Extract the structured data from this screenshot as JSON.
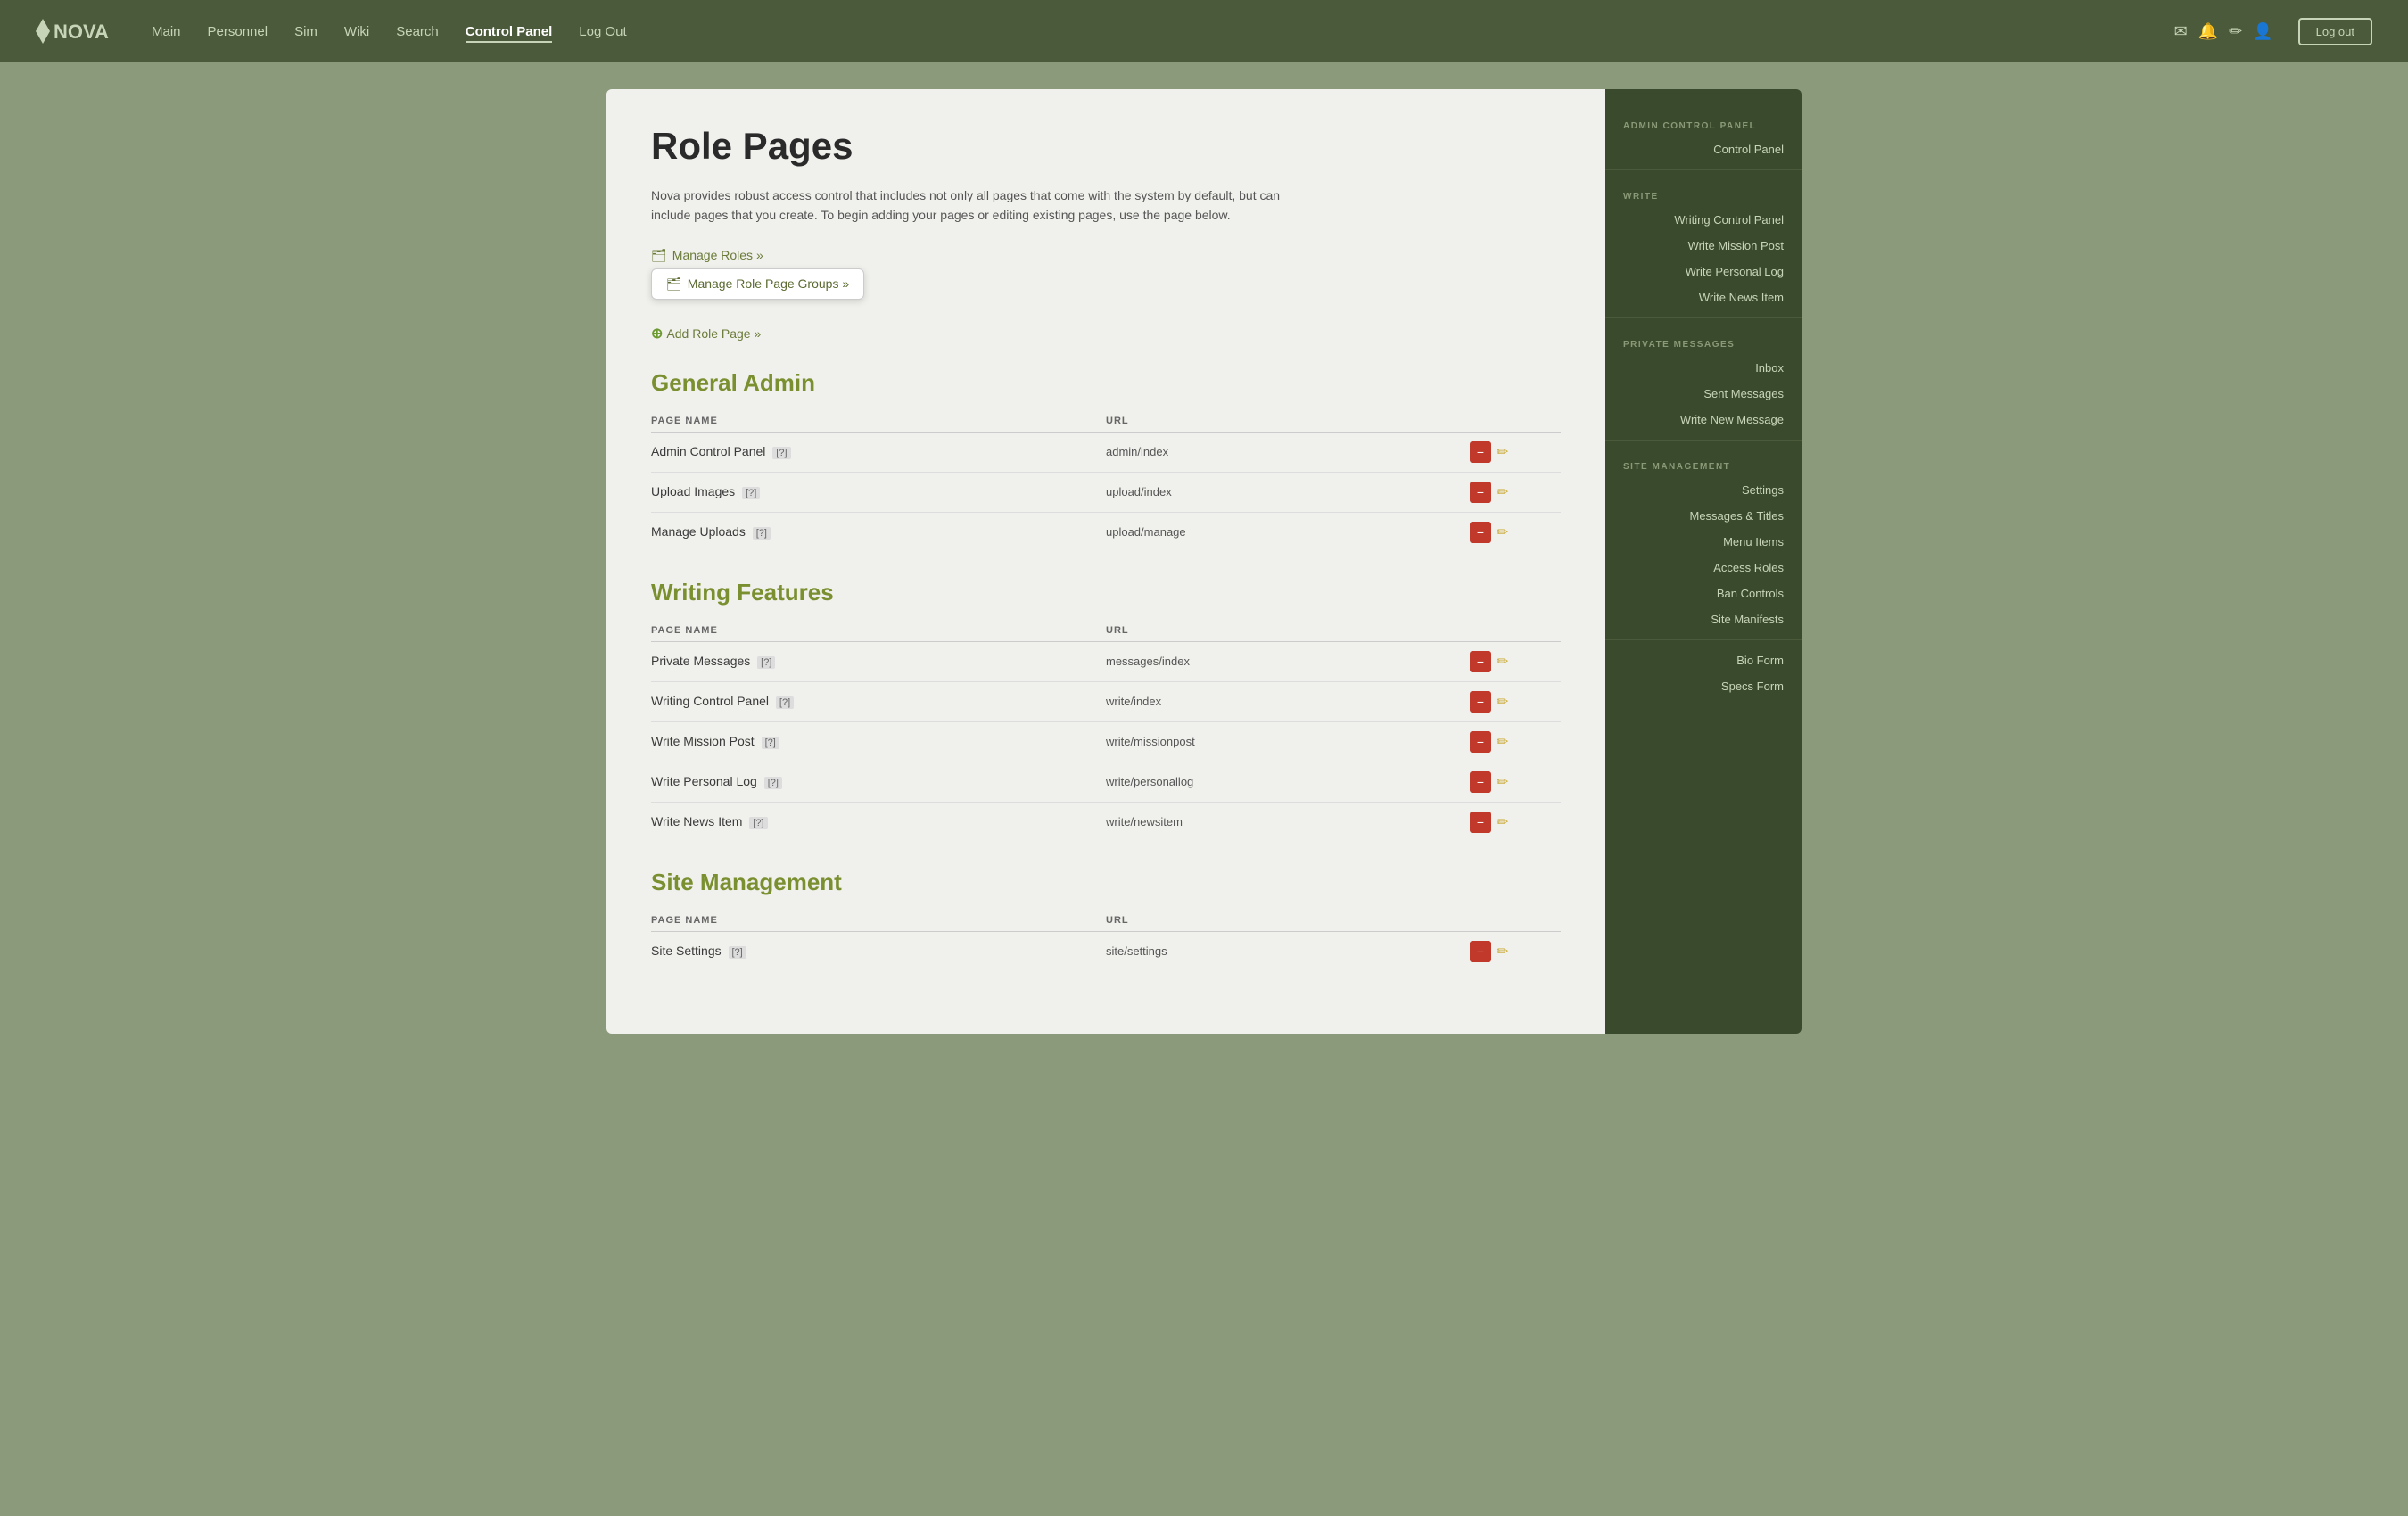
{
  "nav": {
    "logo_text": "NOVA",
    "links": [
      {
        "label": "Main",
        "active": false
      },
      {
        "label": "Personnel",
        "active": false
      },
      {
        "label": "Sim",
        "active": false
      },
      {
        "label": "Wiki",
        "active": false
      },
      {
        "label": "Search",
        "active": false
      },
      {
        "label": "Control Panel",
        "active": true
      },
      {
        "label": "Log Out",
        "active": false
      }
    ],
    "logout_label": "Log out"
  },
  "page": {
    "title": "Role Pages",
    "description": "Nova provides robust access control that includes not only all pages that come with the system by default, but can include pages that you create. To begin adding your pages or editing existing pages, use the page below."
  },
  "actions": {
    "manage_roles_label": "Manage Roles »",
    "manage_role_page_groups_label": "Manage Role Page Groups »",
    "add_role_page_label": "Add Role Page »"
  },
  "sections": [
    {
      "title": "General Admin",
      "col_page_name": "PAGE NAME",
      "col_url": "URL",
      "rows": [
        {
          "name": "Admin Control Panel",
          "help": "[?]",
          "url": "admin/index"
        },
        {
          "name": "Upload Images",
          "help": "[?]",
          "url": "upload/index"
        },
        {
          "name": "Manage Uploads",
          "help": "[?]",
          "url": "upload/manage"
        }
      ]
    },
    {
      "title": "Writing Features",
      "col_page_name": "PAGE NAME",
      "col_url": "URL",
      "rows": [
        {
          "name": "Private Messages",
          "help": "[?]",
          "url": "messages/index"
        },
        {
          "name": "Writing Control Panel",
          "help": "[?]",
          "url": "write/index"
        },
        {
          "name": "Write Mission Post",
          "help": "[?]",
          "url": "write/missionpost"
        },
        {
          "name": "Write Personal Log",
          "help": "[?]",
          "url": "write/personallog"
        },
        {
          "name": "Write News Item",
          "help": "[?]",
          "url": "write/newsitem"
        }
      ]
    },
    {
      "title": "Site Management",
      "col_page_name": "PAGE NAME",
      "col_url": "URL",
      "rows": [
        {
          "name": "Site Settings",
          "help": "[?]",
          "url": "site/settings"
        }
      ]
    }
  ],
  "sidebar": {
    "section_admin": "ADMIN CONTROL PANEL",
    "control_panel": "Control Panel",
    "section_write": "WRITE",
    "write_items": [
      "Writing Control Panel",
      "Write Mission Post",
      "Write Personal Log",
      "Write News Item"
    ],
    "section_private": "PRIVATE MESSAGES",
    "private_items": [
      "Inbox",
      "Sent Messages",
      "Write New Message"
    ],
    "section_site": "SITE MANAGEMENT",
    "site_items": [
      "Settings",
      "Messages & Titles",
      "Menu Items",
      "Access Roles",
      "Ban Controls",
      "Site Manifests"
    ],
    "section_forms": "",
    "form_items": [
      "Bio Form",
      "Specs Form"
    ]
  }
}
